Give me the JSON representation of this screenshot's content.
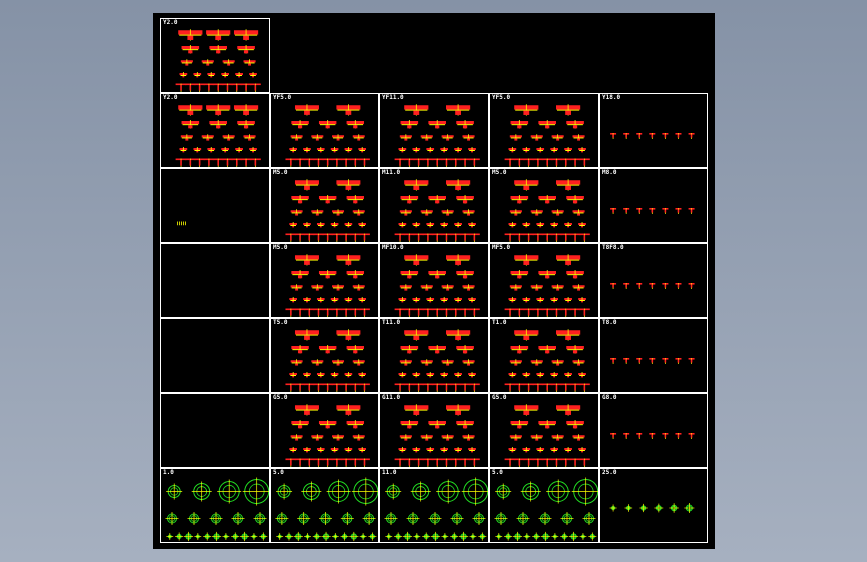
{
  "drawing": {
    "background": "#000000",
    "frame_color": "#ffffff",
    "detail_colors": {
      "flange": "#ff2020",
      "outline": "#ffff00",
      "circle": "#22dd22",
      "accent": "#ffff00"
    },
    "sheets": [
      {
        "id": "r0c0",
        "row": 0,
        "col": 0,
        "label": "Y2.0",
        "kind": "flange-full"
      },
      {
        "id": "r1c0",
        "row": 1,
        "col": 0,
        "label": "Y2.0",
        "kind": "flange-full"
      },
      {
        "id": "r1c1",
        "row": 1,
        "col": 1,
        "label": "YF5.0",
        "kind": "flange"
      },
      {
        "id": "r1c2",
        "row": 1,
        "col": 2,
        "label": "YF11.0",
        "kind": "flange"
      },
      {
        "id": "r1c3",
        "row": 1,
        "col": 3,
        "label": "YF5.0",
        "kind": "flange"
      },
      {
        "id": "r1c4",
        "row": 1,
        "col": 4,
        "label": "Y18.0",
        "kind": "small-row"
      },
      {
        "id": "r2c0",
        "row": 2,
        "col": 0,
        "label": "",
        "kind": "mini"
      },
      {
        "id": "r2c1",
        "row": 2,
        "col": 1,
        "label": "M5.0",
        "kind": "flange"
      },
      {
        "id": "r2c2",
        "row": 2,
        "col": 2,
        "label": "M11.0",
        "kind": "flange"
      },
      {
        "id": "r2c3",
        "row": 2,
        "col": 3,
        "label": "M5.0",
        "kind": "flange"
      },
      {
        "id": "r2c4",
        "row": 2,
        "col": 4,
        "label": "M8.0",
        "kind": "small-row"
      },
      {
        "id": "r3c0",
        "row": 3,
        "col": 0,
        "label": "",
        "kind": "empty"
      },
      {
        "id": "r3c1",
        "row": 3,
        "col": 1,
        "label": "M5.0",
        "kind": "flange"
      },
      {
        "id": "r3c2",
        "row": 3,
        "col": 2,
        "label": "MF10.0",
        "kind": "flange"
      },
      {
        "id": "r3c3",
        "row": 3,
        "col": 3,
        "label": "MF5.0",
        "kind": "flange"
      },
      {
        "id": "r3c4",
        "row": 3,
        "col": 4,
        "label": "T8F8.0",
        "kind": "small-row"
      },
      {
        "id": "r4c0",
        "row": 4,
        "col": 0,
        "label": "",
        "kind": "empty"
      },
      {
        "id": "r4c1",
        "row": 4,
        "col": 1,
        "label": "T5.0",
        "kind": "flange"
      },
      {
        "id": "r4c2",
        "row": 4,
        "col": 2,
        "label": "T11.0",
        "kind": "flange"
      },
      {
        "id": "r4c3",
        "row": 4,
        "col": 3,
        "label": "T1.0",
        "kind": "flange"
      },
      {
        "id": "r4c4",
        "row": 4,
        "col": 4,
        "label": "T8.0",
        "kind": "small-row"
      },
      {
        "id": "r5c0",
        "row": 5,
        "col": 0,
        "label": "",
        "kind": "empty"
      },
      {
        "id": "r5c1",
        "row": 5,
        "col": 1,
        "label": "G5.0",
        "kind": "flange"
      },
      {
        "id": "r5c2",
        "row": 5,
        "col": 2,
        "label": "G11.0",
        "kind": "flange"
      },
      {
        "id": "r5c3",
        "row": 5,
        "col": 3,
        "label": "G5.0",
        "kind": "flange"
      },
      {
        "id": "r5c4",
        "row": 5,
        "col": 4,
        "label": "G8.0",
        "kind": "small-row"
      },
      {
        "id": "r6c0",
        "row": 6,
        "col": 0,
        "label": "1.0",
        "kind": "circles"
      },
      {
        "id": "r6c1",
        "row": 6,
        "col": 1,
        "label": "5.0",
        "kind": "circles"
      },
      {
        "id": "r6c2",
        "row": 6,
        "col": 2,
        "label": "11.0",
        "kind": "circles"
      },
      {
        "id": "r6c3",
        "row": 6,
        "col": 3,
        "label": "5.0",
        "kind": "circles"
      },
      {
        "id": "r6c4",
        "row": 6,
        "col": 4,
        "label": "25.0",
        "kind": "circles-small"
      }
    ]
  }
}
